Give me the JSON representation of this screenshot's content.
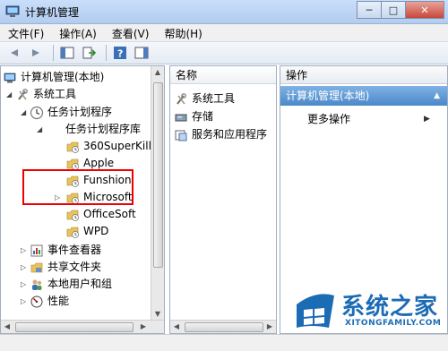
{
  "window": {
    "title": "计算机管理",
    "min": "─",
    "max": "□",
    "close": "✕"
  },
  "menu": [
    "文件(F)",
    "操作(A)",
    "查看(V)",
    "帮助(H)"
  ],
  "tree": {
    "root": "计算机管理(本地)",
    "system_tools": "系统工具",
    "task_scheduler": "任务计划程序",
    "task_library": "任务计划程序库",
    "library_items": [
      "360SuperKille",
      "Apple",
      "Funshion",
      "Microsoft",
      "OfficeSoft",
      "WPD"
    ],
    "more": [
      "事件查看器",
      "共享文件夹",
      "本地用户和组",
      "性能"
    ]
  },
  "list": {
    "header": "名称",
    "items": [
      "系统工具",
      "存储",
      "服务和应用程序"
    ]
  },
  "actions": {
    "header": "操作",
    "section": "计算机管理(本地)",
    "more_actions": "更多操作"
  },
  "watermark": {
    "brand": "系统之家",
    "url": "XITONGFAMILY.COM"
  },
  "colors": {
    "accent": "#4b88c8",
    "highlight": "#ee0000",
    "brand": "#1c6bb5"
  }
}
